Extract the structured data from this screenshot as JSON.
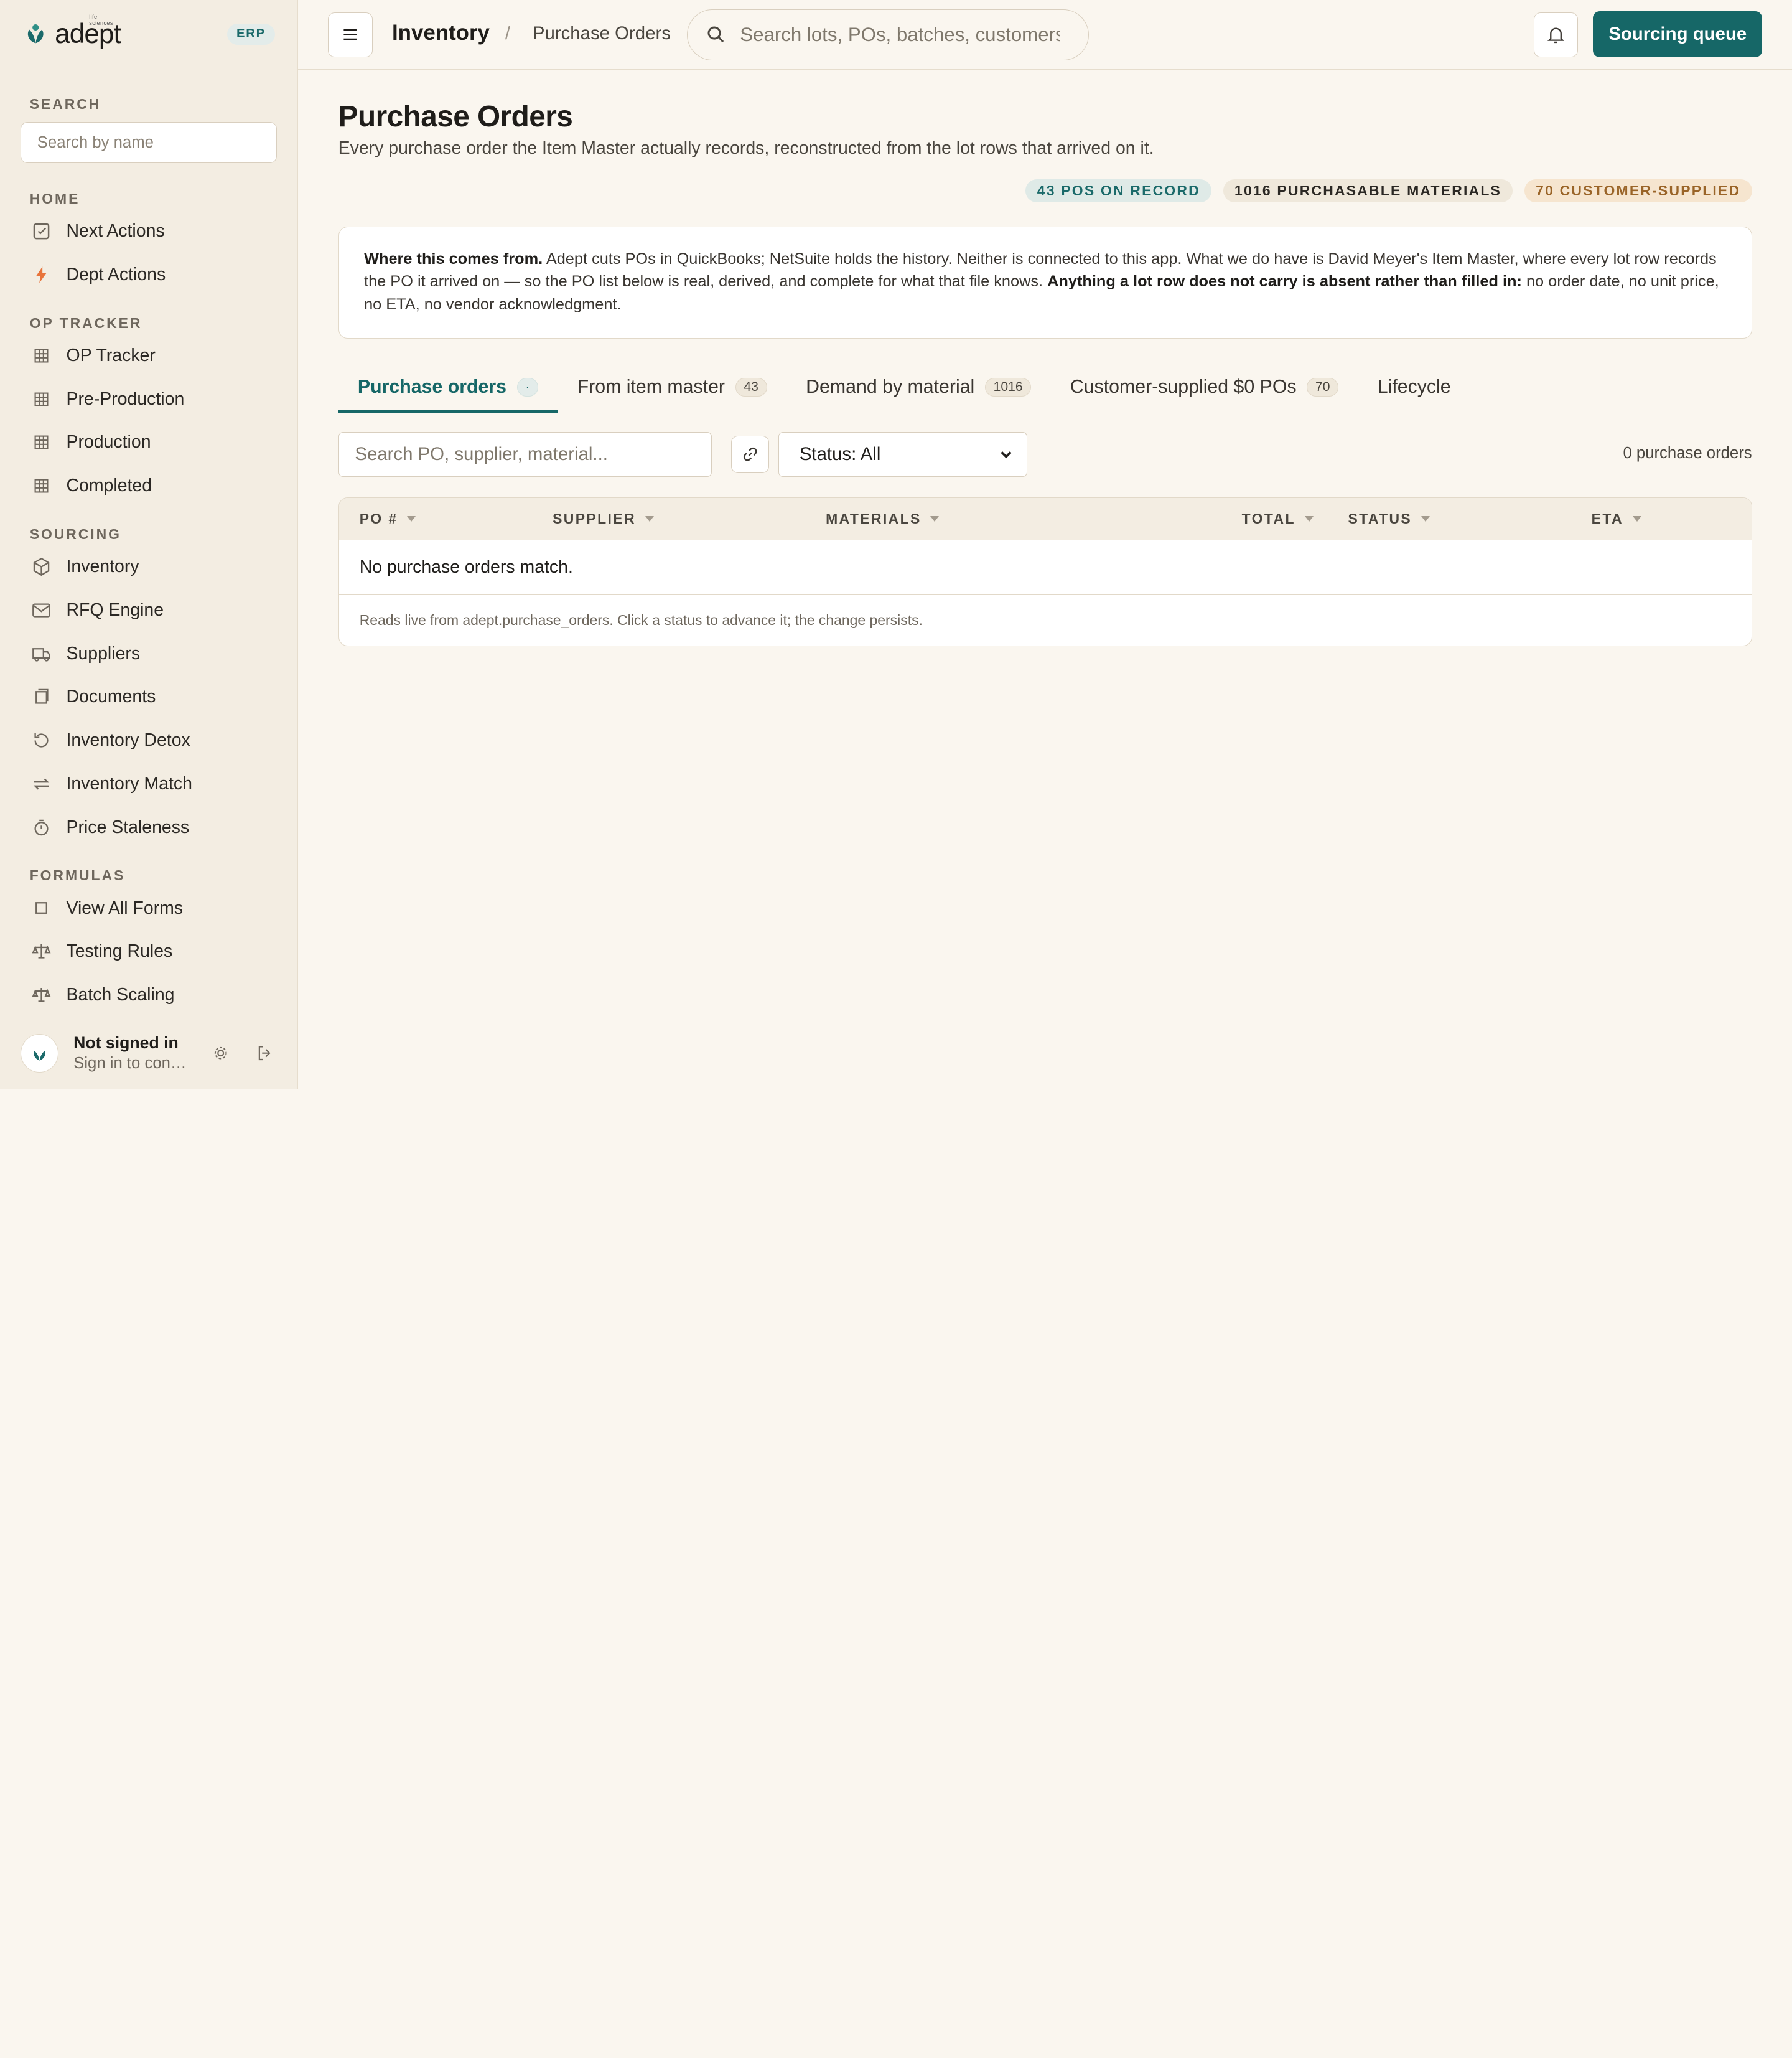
{
  "brand": {
    "name": "adept",
    "tagline": "life sciences",
    "badge": "ERP"
  },
  "sidebar": {
    "search_section": "SEARCH",
    "search_placeholder": "Search by name",
    "sections": [
      {
        "title": "HOME",
        "items": [
          {
            "label": "Next Actions",
            "icon": "checkbox-icon"
          },
          {
            "label": "Dept Actions",
            "icon": "lightning-icon"
          }
        ]
      },
      {
        "title": "OP TRACKER",
        "items": [
          {
            "label": "OP Tracker",
            "icon": "grid-icon"
          },
          {
            "label": "Pre-Production",
            "icon": "grid-icon"
          },
          {
            "label": "Production",
            "icon": "grid-icon"
          },
          {
            "label": "Completed",
            "icon": "grid-icon"
          }
        ]
      },
      {
        "title": "SOURCING",
        "items": [
          {
            "label": "Inventory",
            "icon": "box-icon"
          },
          {
            "label": "RFQ Engine",
            "icon": "mail-icon"
          },
          {
            "label": "Suppliers",
            "icon": "truck-icon"
          },
          {
            "label": "Documents",
            "icon": "document-icon"
          },
          {
            "label": "Inventory Detox",
            "icon": "refresh-icon"
          },
          {
            "label": "Inventory Match",
            "icon": "swap-icon"
          },
          {
            "label": "Price Staleness",
            "icon": "timer-icon"
          }
        ]
      },
      {
        "title": "FORMULAS",
        "items": [
          {
            "label": "View All Forms",
            "icon": "square-icon"
          },
          {
            "label": "Testing Rules",
            "icon": "scale-icon"
          },
          {
            "label": "Batch Scaling",
            "icon": "scale-icon"
          }
        ]
      }
    ],
    "user": {
      "name": "Not signed in",
      "subtitle": "Sign in to continue"
    }
  },
  "topbar": {
    "breadcrumb_main": "Inventory",
    "breadcrumb_sep": "/",
    "breadcrumb_sub": "Purchase Orders",
    "search_placeholder": "Search lots, POs, batches, customers",
    "primary_button": "Sourcing queue",
    "accent": "#166767"
  },
  "page": {
    "title": "Purchase Orders",
    "subtitle": "Every purchase order the Item Master actually records, reconstructed from the lot rows that arrived on it.",
    "pills": [
      {
        "label": "43 POS ON RECORD",
        "tone": "teal"
      },
      {
        "label": "1016 PURCHASABLE MATERIALS",
        "tone": "neutral"
      },
      {
        "label": "70 CUSTOMER-SUPPLIED",
        "tone": "amber"
      }
    ],
    "notice": {
      "lead": "Where this comes from.",
      "body": " Adept cuts POs in QuickBooks; NetSuite holds the history. Neither is connected to this app. What we do have is David Meyer's Item Master, where every lot row records the PO it arrived on — so the PO list below is real, derived, and complete for what that file knows. ",
      "emphasis": "Anything a lot row does not carry is absent rather than filled in:",
      "tail": " no order date, no unit price, no ETA, no vendor acknowledgment."
    },
    "tabs": [
      {
        "label": "Purchase orders",
        "count": "·",
        "active": true
      },
      {
        "label": "From item master",
        "count": "43"
      },
      {
        "label": "Demand by material",
        "count": "1016"
      },
      {
        "label": "Customer-supplied $0 POs",
        "count": "70"
      },
      {
        "label": "Lifecycle",
        "count": ""
      }
    ],
    "filters": {
      "search_placeholder": "Search PO, supplier, material...",
      "status_value": "Status: All",
      "result_count": "0 purchase orders"
    },
    "table": {
      "columns": [
        "PO #",
        "SUPPLIER",
        "MATERIALS",
        "TOTAL",
        "STATUS",
        "ETA"
      ],
      "empty_message": "No purchase orders match.",
      "footer": "Reads live from adept.purchase_orders. Click a status to advance it; the change persists."
    }
  }
}
